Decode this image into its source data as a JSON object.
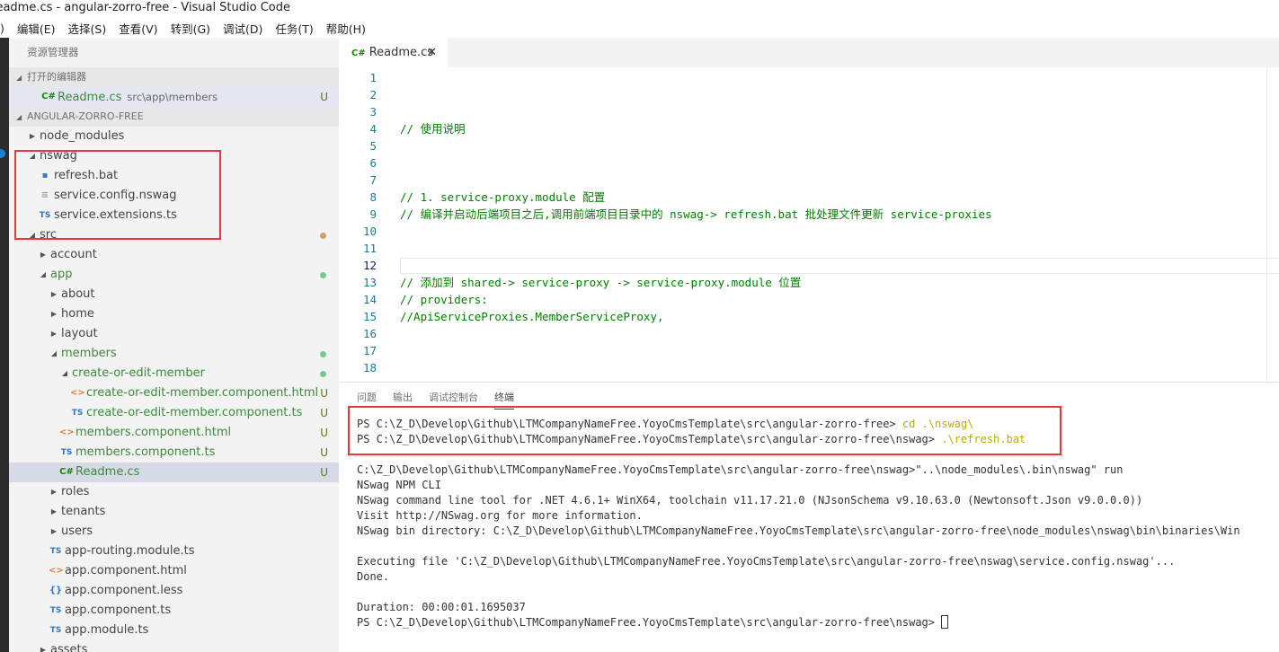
{
  "window": {
    "title": "Readme.cs - angular-zorro-free - Visual Studio Code"
  },
  "menu": [
    {
      "label": ")"
    },
    {
      "label": "编辑(E)"
    },
    {
      "label": "选择(S)"
    },
    {
      "label": "查看(V)"
    },
    {
      "label": "转到(G)"
    },
    {
      "label": "调试(D)"
    },
    {
      "label": "任务(T)"
    },
    {
      "label": "帮助(H)"
    }
  ],
  "sidebar": {
    "title": "资源管理器",
    "open_editors": {
      "header": "打开的编辑器",
      "item": {
        "name": "Readme.cs",
        "path": "src\\app\\members",
        "badge": "U"
      }
    },
    "project": {
      "header": "ANGULAR-ZORRO-FREE",
      "rows": [
        {
          "label": "node_modules",
          "indent": 0,
          "twisty": "closed",
          "icon": ""
        },
        {
          "label": "nswag",
          "indent": 0,
          "twisty": "open",
          "icon": ""
        },
        {
          "label": "refresh.bat",
          "indent": 1,
          "twisty": "",
          "icon": "bat"
        },
        {
          "label": "service.config.nswag",
          "indent": 1,
          "twisty": "",
          "icon": "doc"
        },
        {
          "label": "service.extensions.ts",
          "indent": 1,
          "twisty": "",
          "icon": "ts"
        },
        {
          "label": "src",
          "indent": 0,
          "twisty": "open",
          "icon": "",
          "dot": "orange"
        },
        {
          "label": "account",
          "indent": 1,
          "twisty": "closed",
          "icon": ""
        },
        {
          "label": "app",
          "indent": 1,
          "twisty": "open",
          "icon": "",
          "color": "green",
          "dot": "green"
        },
        {
          "label": "about",
          "indent": 2,
          "twisty": "closed",
          "icon": ""
        },
        {
          "label": "home",
          "indent": 2,
          "twisty": "closed",
          "icon": ""
        },
        {
          "label": "layout",
          "indent": 2,
          "twisty": "closed",
          "icon": ""
        },
        {
          "label": "members",
          "indent": 2,
          "twisty": "open",
          "icon": "",
          "color": "green",
          "dot": "green"
        },
        {
          "label": "create-or-edit-member",
          "indent": 3,
          "twisty": "open",
          "icon": "",
          "color": "green",
          "dot": "green"
        },
        {
          "label": "create-or-edit-member.component.html",
          "indent": 4,
          "twisty": "",
          "icon": "html",
          "color": "green",
          "badge": "U"
        },
        {
          "label": "create-or-edit-member.component.ts",
          "indent": 4,
          "twisty": "",
          "icon": "ts",
          "color": "green",
          "badge": "U"
        },
        {
          "label": "members.component.html",
          "indent": 3,
          "twisty": "",
          "icon": "html",
          "color": "green",
          "badge": "U"
        },
        {
          "label": "members.component.ts",
          "indent": 3,
          "twisty": "",
          "icon": "ts",
          "color": "green",
          "badge": "U"
        },
        {
          "label": "Readme.cs",
          "indent": 3,
          "twisty": "",
          "icon": "cs",
          "color": "green",
          "badge": "U",
          "selected": true
        },
        {
          "label": "roles",
          "indent": 2,
          "twisty": "closed",
          "icon": ""
        },
        {
          "label": "tenants",
          "indent": 2,
          "twisty": "closed",
          "icon": ""
        },
        {
          "label": "users",
          "indent": 2,
          "twisty": "closed",
          "icon": ""
        },
        {
          "label": "app-routing.module.ts",
          "indent": 2,
          "twisty": "",
          "icon": "ts"
        },
        {
          "label": "app.component.html",
          "indent": 2,
          "twisty": "",
          "icon": "html"
        },
        {
          "label": "app.component.less",
          "indent": 2,
          "twisty": "",
          "icon": "less"
        },
        {
          "label": "app.component.ts",
          "indent": 2,
          "twisty": "",
          "icon": "ts"
        },
        {
          "label": "app.module.ts",
          "indent": 2,
          "twisty": "",
          "icon": "ts"
        },
        {
          "label": "assets",
          "indent": 1,
          "twisty": "closed",
          "icon": ""
        }
      ]
    }
  },
  "icons": {
    "cs": "C#",
    "ts": "TS",
    "html": "<>",
    "less": "{}",
    "bat": "▪",
    "doc": "≡",
    "twisty_open": "◢",
    "twisty_closed": "▶",
    "close": "✕"
  },
  "editor": {
    "tab": {
      "name": "Readme.cs"
    },
    "current_line": 12,
    "lines": [
      {
        "n": "1",
        "text": ""
      },
      {
        "n": "2",
        "text": ""
      },
      {
        "n": "3",
        "text": ""
      },
      {
        "n": "4",
        "text": "// 使用说明"
      },
      {
        "n": "5",
        "text": ""
      },
      {
        "n": "6",
        "text": ""
      },
      {
        "n": "7",
        "text": ""
      },
      {
        "n": "8",
        "text": "// 1. service-proxy.module 配置"
      },
      {
        "n": "9",
        "text": "// 编译并启动后端项目之后,调用前端项目目录中的 nswag-> refresh.bat 批处理文件更新 service-proxies"
      },
      {
        "n": "10",
        "text": ""
      },
      {
        "n": "11",
        "text": ""
      },
      {
        "n": "12",
        "text": ""
      },
      {
        "n": "13",
        "text": "// 添加到 shared-> service-proxy -> service-proxy.module 位置"
      },
      {
        "n": "14",
        "text": "// providers:"
      },
      {
        "n": "15",
        "text": "//ApiServiceProxies.MemberServiceProxy,"
      },
      {
        "n": "16",
        "text": ""
      },
      {
        "n": "17",
        "text": ""
      },
      {
        "n": "18",
        "text": ""
      }
    ]
  },
  "panel": {
    "tabs": [
      {
        "label": "问题",
        "active": false
      },
      {
        "label": "输出",
        "active": false
      },
      {
        "label": "调试控制台",
        "active": false
      },
      {
        "label": "终端",
        "active": true
      }
    ],
    "terminal": [
      {
        "prompt": "PS C:\\Z_D\\Develop\\Github\\LTMCompanyNameFree.YoyoCmsTemplate\\src\\angular-zorro-free> ",
        "cmd": "cd .\\nswag\\"
      },
      {
        "prompt": "PS C:\\Z_D\\Develop\\Github\\LTMCompanyNameFree.YoyoCmsTemplate\\src\\angular-zorro-free\\nswag> ",
        "cmd": ".\\refresh.bat"
      },
      {
        "prompt": "",
        "cmd": ""
      },
      {
        "prompt": "C:\\Z_D\\Develop\\Github\\LTMCompanyNameFree.YoyoCmsTemplate\\src\\angular-zorro-free\\nswag>\"..\\node_modules\\.bin\\nswag\" run",
        "cmd": ""
      },
      {
        "prompt": "NSwag NPM CLI",
        "cmd": ""
      },
      {
        "prompt": "NSwag command line tool for .NET 4.6.1+ WinX64, toolchain v11.17.21.0 (NJsonSchema v9.10.63.0 (Newtonsoft.Json v9.0.0.0))",
        "cmd": ""
      },
      {
        "prompt": "Visit http://NSwag.org for more information.",
        "cmd": ""
      },
      {
        "prompt": "NSwag bin directory: C:\\Z_D\\Develop\\Github\\LTMCompanyNameFree.YoyoCmsTemplate\\src\\angular-zorro-free\\node_modules\\nswag\\bin\\binaries\\Win",
        "cmd": ""
      },
      {
        "prompt": "",
        "cmd": ""
      },
      {
        "prompt": "Executing file 'C:\\Z_D\\Develop\\Github\\LTMCompanyNameFree.YoyoCmsTemplate\\src\\angular-zorro-free\\nswag\\service.config.nswag'...",
        "cmd": ""
      },
      {
        "prompt": "Done.",
        "cmd": ""
      },
      {
        "prompt": "",
        "cmd": ""
      },
      {
        "prompt": "Duration: 00:00:01.1695037",
        "cmd": ""
      },
      {
        "prompt": "PS C:\\Z_D\\Develop\\Github\\LTMCompanyNameFree.YoyoCmsTemplate\\src\\angular-zorro-free\\nswag> ",
        "cmd": "",
        "cursor": true
      }
    ]
  },
  "colors": {
    "annotation_box": "#e8373c",
    "comment": "#008000",
    "untracked": "#587c0c",
    "terminal_cmd": "#b5ad0e"
  }
}
